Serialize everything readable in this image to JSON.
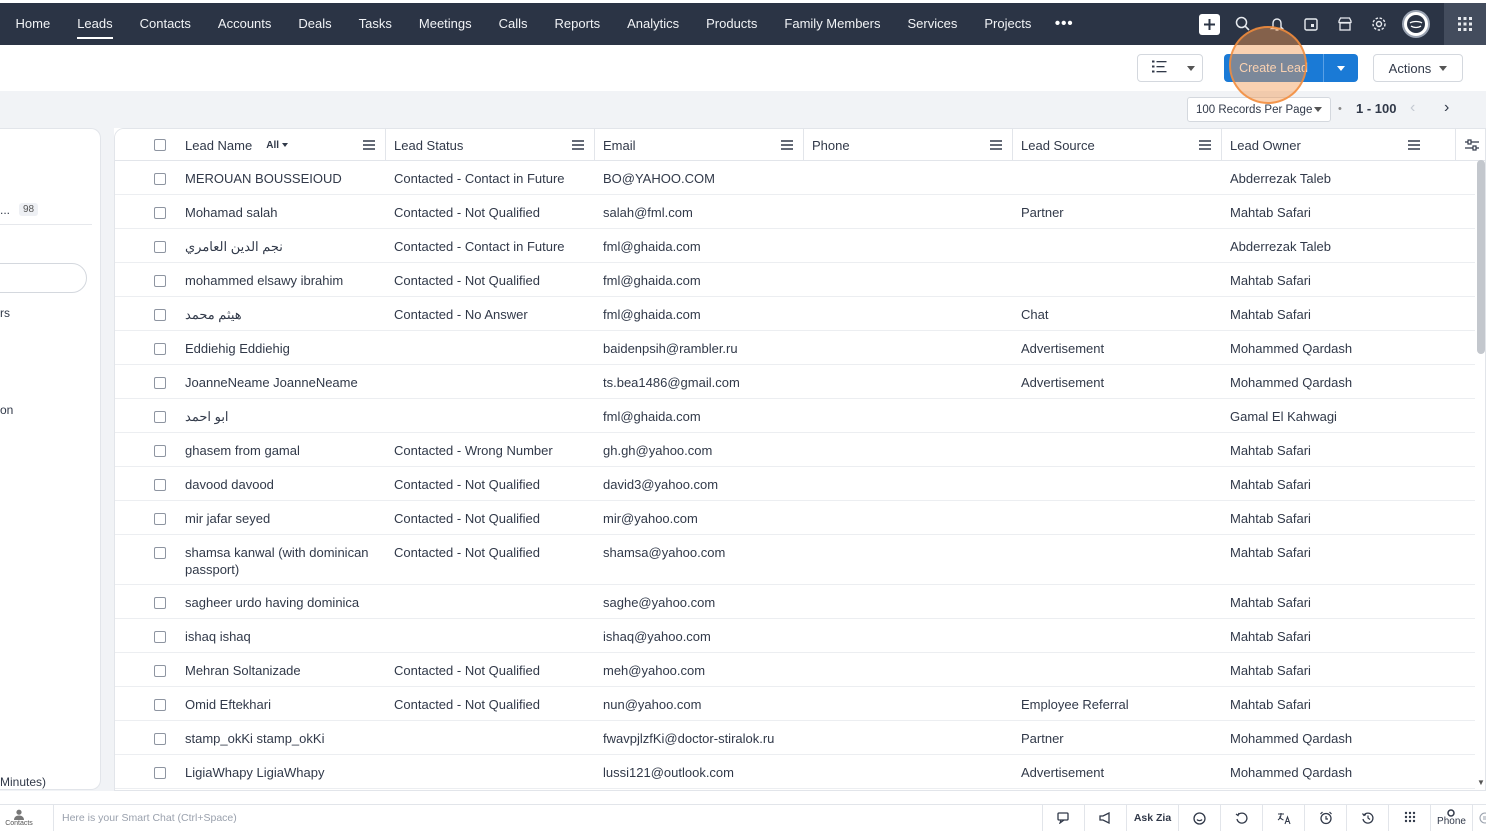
{
  "nav": {
    "tabs": [
      "Home",
      "Leads",
      "Contacts",
      "Accounts",
      "Deals",
      "Tasks",
      "Meetings",
      "Calls",
      "Reports",
      "Analytics",
      "Products",
      "Family Members",
      "Services",
      "Projects"
    ],
    "active_tab": "Leads",
    "more": "•••",
    "icons": [
      "plus-icon",
      "search-icon",
      "bell-icon",
      "calendar-icon",
      "marketplace-icon",
      "settings-icon",
      "avatar",
      "apps-grid-icon"
    ]
  },
  "toolbar": {
    "view_icon": "list-view-icon",
    "create_label": "Create Lead",
    "actions_label": "Actions"
  },
  "pagination": {
    "records_per_page": "100 Records Per Page",
    "range": "1 - 100"
  },
  "left_panel": {
    "count_badge": "98",
    "truncated_1": "...",
    "truncated_2": "rs",
    "truncated_3": "on",
    "truncated_4": "Minutes)"
  },
  "table": {
    "all_filter": "All",
    "columns": [
      "Lead Name",
      "Lead Status",
      "Email",
      "Phone",
      "Lead Source",
      "Lead Owner"
    ],
    "rows": [
      {
        "name": "MEROUAN BOUSSEIOUD",
        "status": "Contacted - Contact in Future",
        "email": "BO@YAHOO.COM",
        "phone": "",
        "source": "",
        "owner": "Abderrezak Taleb"
      },
      {
        "name": "Mohamad salah",
        "status": "Contacted - Not Qualified",
        "email": "salah@fml.com",
        "phone": "",
        "source": "Partner",
        "owner": "Mahtab Safari"
      },
      {
        "name": "نجم الدين العامري",
        "status": "Contacted - Contact in Future",
        "email": "fml@ghaida.com",
        "phone": "",
        "source": "",
        "owner": "Abderrezak Taleb"
      },
      {
        "name": "mohammed elsawy ibrahim",
        "status": "Contacted - Not Qualified",
        "email": "fml@ghaida.com",
        "phone": "",
        "source": "",
        "owner": "Mahtab Safari"
      },
      {
        "name": "هيثم محمد",
        "status": "Contacted - No Answer",
        "email": "fml@ghaida.com",
        "phone": "",
        "source": "Chat",
        "owner": "Mahtab Safari"
      },
      {
        "name": "Eddiehig Eddiehig",
        "status": "",
        "email": "baidenpsih@rambler.ru",
        "phone": "",
        "source": "Advertisement",
        "owner": "Mohammed Qardash"
      },
      {
        "name": "JoanneNeame JoanneNeame",
        "status": "",
        "email": "ts.bea1486@gmail.com",
        "phone": "",
        "source": "Advertisement",
        "owner": "Mohammed Qardash"
      },
      {
        "name": "ابو احمد",
        "status": "",
        "email": "fml@ghaida.com",
        "phone": "",
        "source": "",
        "owner": "Gamal El Kahwagi"
      },
      {
        "name": "ghasem from gamal",
        "status": "Contacted - Wrong Number",
        "email": "gh.gh@yahoo.com",
        "phone": "",
        "source": "",
        "owner": "Mahtab Safari"
      },
      {
        "name": "davood davood",
        "status": "Contacted - Not Qualified",
        "email": "david3@yahoo.com",
        "phone": "",
        "source": "",
        "owner": "Mahtab Safari"
      },
      {
        "name": "mir jafar seyed",
        "status": "Contacted - Not Qualified",
        "email": "mir@yahoo.com",
        "phone": "",
        "source": "",
        "owner": "Mahtab Safari"
      },
      {
        "name": "shamsa kanwal (with dominican passport)",
        "status": "Contacted - Not Qualified",
        "email": "shamsa@yahoo.com",
        "phone": "",
        "source": "",
        "owner": "Mahtab Safari"
      },
      {
        "name": "sagheer urdo having dominica",
        "status": "",
        "email": "saghe@yahoo.com",
        "phone": "",
        "source": "",
        "owner": "Mahtab Safari"
      },
      {
        "name": "ishaq ishaq",
        "status": "",
        "email": "ishaq@yahoo.com",
        "phone": "",
        "source": "",
        "owner": "Mahtab Safari"
      },
      {
        "name": "Mehran Soltanizade",
        "status": "Contacted - Not Qualified",
        "email": "meh@yahoo.com",
        "phone": "",
        "source": "",
        "owner": "Mahtab Safari"
      },
      {
        "name": "Omid Eftekhari",
        "status": "Contacted - Not Qualified",
        "email": "nun@yahoo.com",
        "phone": "",
        "source": "Employee Referral",
        "owner": "Mahtab Safari"
      },
      {
        "name": "stamp_okKi stamp_okKi",
        "status": "",
        "email": "fwavpjlzfKi@doctor-stiralok.ru",
        "phone": "",
        "source": "Partner",
        "owner": "Mohammed Qardash"
      },
      {
        "name": "LigiaWhapy LigiaWhapy",
        "status": "",
        "email": "lussi121@outlook.com",
        "phone": "",
        "source": "Advertisement",
        "owner": "Mohammed Qardash"
      }
    ]
  },
  "bottom_bar": {
    "contacts_label": "Contacts",
    "smart_chat": "Here is your Smart Chat (Ctrl+Space)",
    "ask_zia": "Ask Zia",
    "phone_label": "Phone"
  },
  "colors": {
    "nav_bg": "#2b3445",
    "primary": "#1a7ad6",
    "highlight": "#f29852"
  }
}
